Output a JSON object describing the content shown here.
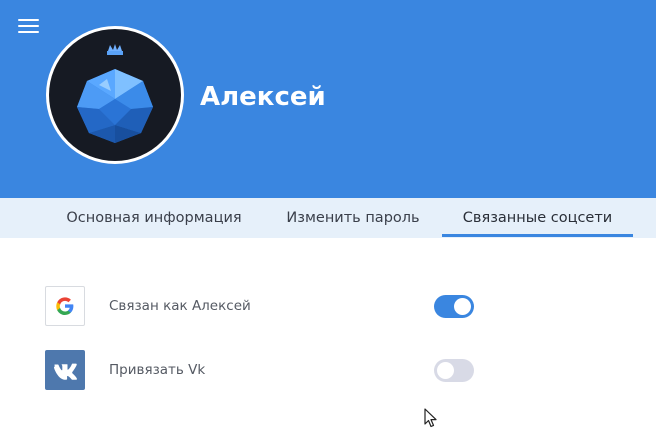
{
  "profile": {
    "name": "Алексей"
  },
  "tabs": [
    {
      "label": "Основная информация"
    },
    {
      "label": "Изменить пароль"
    },
    {
      "label": "Связанные соцсети",
      "active": true
    }
  ],
  "socials": [
    {
      "provider": "Google",
      "icon": "google-icon",
      "label": "Связан как Алексей",
      "connected": true
    },
    {
      "provider": "Vk",
      "icon": "vk-icon",
      "label": "Привязать Vk",
      "connected": false
    }
  ],
  "colors": {
    "accent": "#3a86e0",
    "tab_bar": "#e6f0fa",
    "vk": "#4e78ad",
    "toggle_off": "#d8dae6"
  }
}
